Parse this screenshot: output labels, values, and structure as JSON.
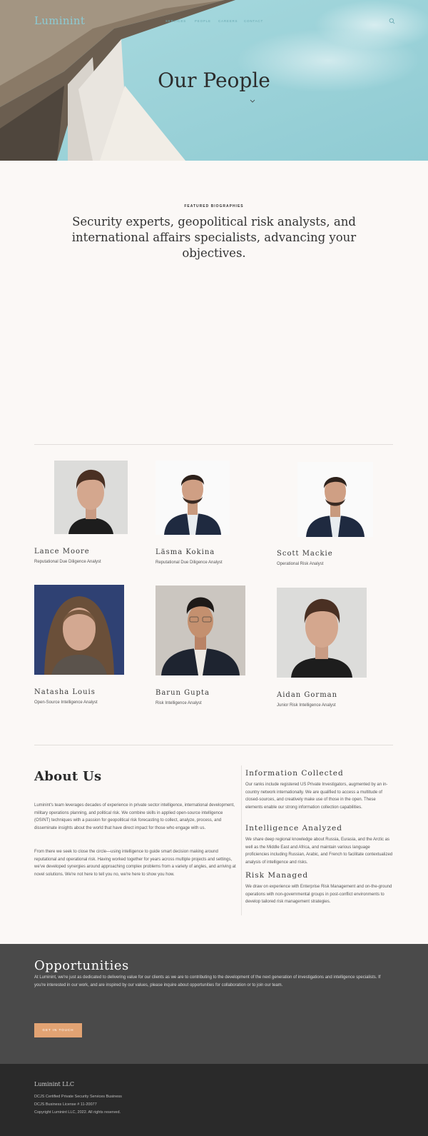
{
  "header": {
    "logo": "Luminint",
    "nav": [
      "SERVICES",
      "PEOPLE",
      "CAREERS",
      "CONTACT"
    ],
    "search_icon": "search-icon"
  },
  "hero": {
    "title": "Our People"
  },
  "featured": {
    "eyebrow": "FEATURED BIOGRAPHIES",
    "lead": "Security experts, geopolitical risk analysts, and international affairs specialists, advancing your objectives."
  },
  "people": [
    {
      "name": "Lance Moore",
      "role": "Reputational Due Diligence Analyst"
    },
    {
      "name": "Läsma Kokina",
      "role": "Reputational Due Diligence Analyst"
    },
    {
      "name": "Scott Mackie",
      "role": "Operational Risk Analyst"
    },
    {
      "name": "Natasha Louis",
      "role": "Open-Source Intelligence Analyst"
    },
    {
      "name": "Barun Gupta",
      "role": "Risk Intelligence Analyst"
    },
    {
      "name": "Aidan Gorman",
      "role": "Junior Risk Intelligence Analyst"
    }
  ],
  "about": {
    "title": "About Us",
    "p1": "Luminint's team leverages decades of experience in private sector intelligence, international development, military operations planning, and political risk. We combine skills in applied open-source intelligence (OSINT) techniques with a passion for geopolitical risk forecasting to collect, analyze, process, and disseminate insights about the world that have direct impact for those who engage with us.",
    "p2": "From there we seek to close the circle—using intelligence to guide smart decision making around reputational and operational risk. Having worked together for years across multiple projects and settings, we've developed synergies around approaching complex problems from a variety of angles, and arriving at novel solutions. We're not here to tell you no, we're here to show you how.",
    "sections": [
      {
        "heading": "Information Collected",
        "text": "Our ranks include registered US Private Investigators, augmented by an in-country network internationally. We are qualified to access a multitude of closed-sources, and creatively make use of those in the open. These elements enable our strong information collection capabilities."
      },
      {
        "heading": "Intelligence Analyzed",
        "text": "We share deep regional knowledge about Russia, Eurasia, and the Arctic as well as the Middle East and Africa, and maintain various language proficiencies including Russian, Arabic, and French to facilitate contextualized analysis of intelligence and risks."
      },
      {
        "heading": "Risk Managed",
        "text": "We draw on experience with Enterprise Risk Management and on-the-ground operations with non-governmental groups in post-conflict environments to develop tailored risk management strategies."
      }
    ]
  },
  "opportunities": {
    "title": "Opportunities",
    "text": "At Luminint, we're just as dedicated to delivering value for our clients as we are to contributing to the development of the next generation of investigations and intelligence specialists. If you're interested in our work, and are inspired by our values, please inquire about opportunities for collaboration or to join our team.",
    "button": "GET IN TOUCH"
  },
  "footer": {
    "brand": "Luminint LLC",
    "lines": [
      "DCJS Certified Private Security Services Business",
      "DCJS Business License # 11-20077",
      "Copyright Luminint LLC, 2022.  All rights reserved."
    ]
  },
  "colors": {
    "accent": "#e2a373",
    "sky": "#9fd4da",
    "dark_band": "#4a4a4a",
    "footer_bg": "#2a2a2a",
    "page_bg": "#fbf8f6"
  }
}
